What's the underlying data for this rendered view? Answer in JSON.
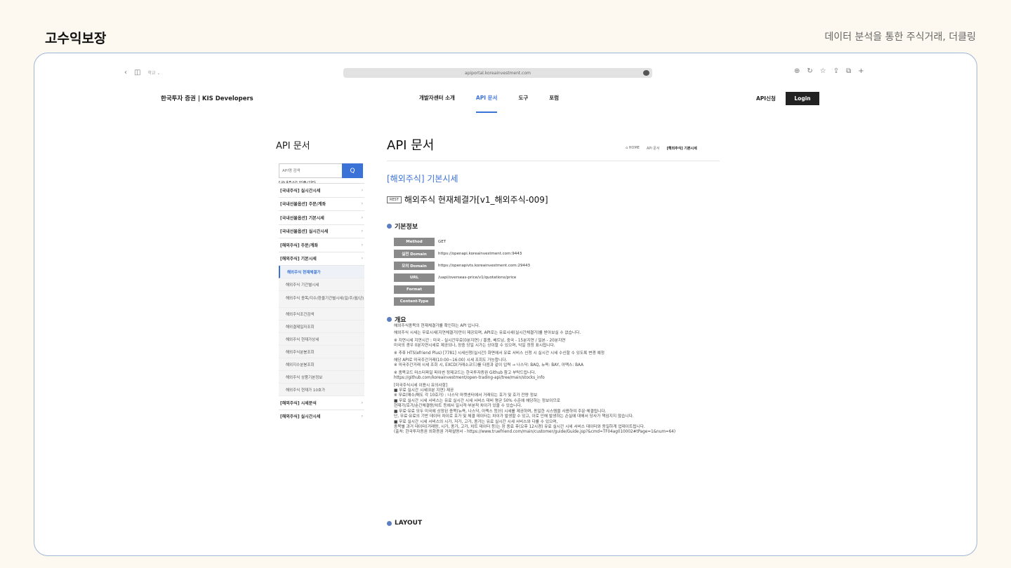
{
  "slide": {
    "title": "고수익보장",
    "subtitle": "데이터 분석을 통한 주식거래, 더클링"
  },
  "browser": {
    "back_icon": "‹",
    "sidebar_icon": "◫",
    "profile": "학교 ⌄",
    "url": "apiportal.koreainvestment.com",
    "download_icon": "⊕",
    "reload_icon": "↻",
    "star_icon": "☆",
    "share_icon": "⇪",
    "tabs_icon": "⧉",
    "add_tab_icon": "+"
  },
  "header": {
    "brand": "한국투자 증권 | KIS Developers",
    "nav": [
      "개발자센터 소개",
      "API 문서",
      "도구",
      "포럼"
    ],
    "api_request": "API신청",
    "login": "Login"
  },
  "sidebar": {
    "title": "API 문서",
    "search_placeholder": "API명 검색",
    "search_icon": "Q",
    "cut_top": "[국내주식] 업종/기타",
    "categories_top": [
      "[국내주식] 실시간시세",
      "[국내선물옵션] 주문/계좌",
      "[국내선물옵션] 기본시세",
      "[국내선물옵션] 실시간시세",
      "[해외주식] 주문/계좌",
      "[해외주식] 기본시세"
    ],
    "subitems": [
      "해외주식 현재체결가",
      "해외주식 기간별시세",
      "해외주식 종목/지수/환율기간별시세(일/주/월/년)",
      "해외주식조건검색",
      "해외결제일자조회",
      "해외주식 현재가상세",
      "해외주식분봉조회",
      "해외지수분봉조회",
      "해외주식 상품기본정보",
      "해외주식 현재가 10호가"
    ],
    "categories_bottom": [
      "[해외주식] 시세분석",
      "[해외주식] 실시간시세"
    ],
    "chevron": "›"
  },
  "main": {
    "title": "API 문서",
    "breadcrumb": [
      "⌂ HOME",
      "API 문서",
      "[해외주식] 기본시세"
    ],
    "section_title": "[해외주식] 기본시세",
    "rest_tag": "REST",
    "api_title": "해외주식 현재체결가[v1_해외주식-009]",
    "basic_info_heading": "기본정보",
    "info_rows": [
      {
        "key": "Method",
        "value": "GET"
      },
      {
        "key": "실전 Domain",
        "value": "https://openapi.koreainvestment.com:9443"
      },
      {
        "key": "모의 Domain",
        "value": "https://openapivts.koreainvestment.com:29443"
      },
      {
        "key": "URL",
        "value": "/uapi/overseas-price/v1/quotations/price"
      },
      {
        "key": "Format",
        "value": ""
      },
      {
        "key": "Content-Type",
        "value": ""
      }
    ],
    "overview_heading": "개요",
    "overview_paragraphs": [
      "해외주식종목의 현재체결가를 확인하는 API 입니다.",
      "해외주식 시세는 무료시세(지연체결가)만이 제공되며, API로는 유료시세(실시간체결가)를 받아보실 수 없습니다.",
      "※ 지연시세 지연시간 : 미국 - 실시간무료(0분지연) / 홍콩, 베트남, 중국 - 15분지연 / 일본 - 20분지연\n미국의 경우 0분지연시세로 제공되나, 장중 당일 시가는 상이할 수 있으며, 익일 정정 표시됩니다.",
      "※ 추후 HTS(efriend Plus) [7781] 시세신청(실시간) 화면에서 유료 서비스 신청 시 실시간 시세 수신할 수 있도록 변경 예정",
      "해당 API로 미국주간거래(10:00~16:00) 시세 조회도 가능합니다.\n※ 미국주간거래 시세 조회 시, EXCD(거래소코드)를 다음과 같이 입력 → 나스닥: BAQ, 뉴욕: BAY, 아멕스: BAA",
      "※ 종목코드 마스터파일 파이썬 정제코드는 한국투자증권 Github 참고 부탁드립니다.\nhttps://github.com/koreainvestment/open-trading-api/tree/main/stocks_info",
      "[미국주식시세 이용시 유의사항]\n■ 무료 실시간 시세(0분 지연) 제공\n※ 무료(매수/매도 각 10호가) : 나스닥 마켓센터에서 거래되는 호가 및 호가 잔량 정보\n■ 무료 실시간 시세 서비스는 유료 실시간 시세 서비스 대비 평균 50% 수준에 해당하는 정보이므로\n현재가/호가/순간체결량/차트 등에서 일시적·부분적 차이가 있을 수 있습니다.\n■ 무료·유료 모두 미국에 상장된 종목(뉴욕, 나스닥, 아멕스 등)의 시세를 제공하며, 동일한 시스템을 사용하여 주문·체결됩니다.\n단, 무료·유료의 기반 데이터 차이로 호가 및 체결 데이터는 차이가 발생할 수 있고, 이로 인해 발생하는 손실에 대해서 당사가 책임지지 않습니다.\n■ 무료 실시간 시세 서비스의 시가, 저가, 고가, 종가는 유료 실시간 시세 서비스와 다를 수 있으며,\n종목별 과거 데이터(거래량, 시가, 종가, 고가, 차트 데이터 등)는 장 종료 후(오후 12시경) 유료 실시간 시세 서비스 데이터와 동일하게 업데이트됩니다.\n(출처: 한국투자증권 외화증권 거래설명서 - https://www.truefriend.com/main/customer/guide/Guide.jsp?&cmd=TF04ag010002#tPage=1&num=64)"
    ],
    "layout_heading": "LAYOUT"
  },
  "colors": {
    "accent": "#3a72d8",
    "frame_border": "#9fb6d4",
    "background": "#fdf9f0"
  }
}
